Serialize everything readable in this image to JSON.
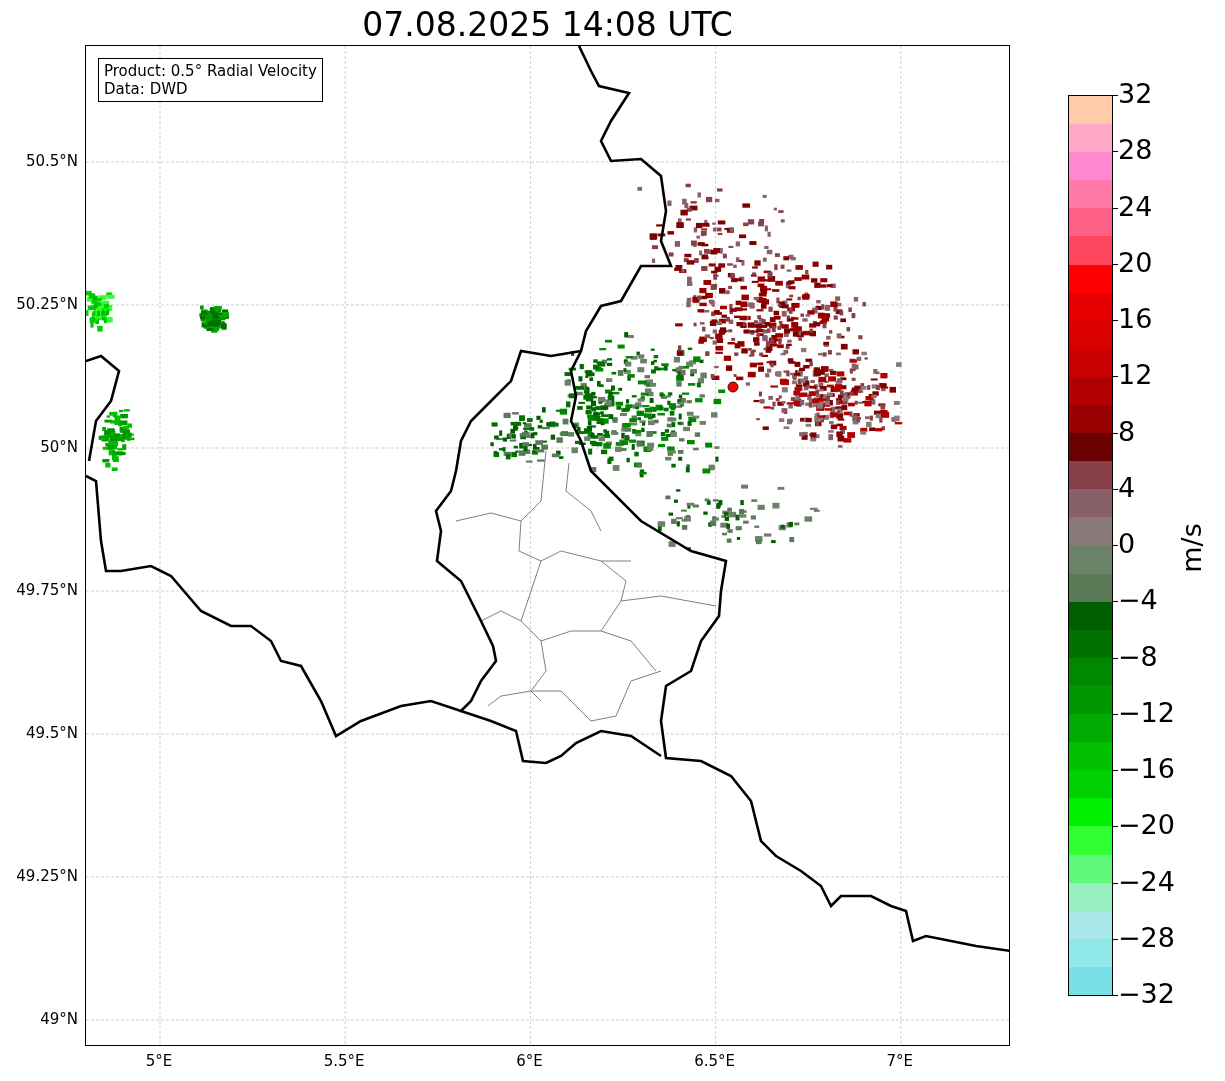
{
  "title": "07.08.2025 14:08 UTC",
  "info_box": {
    "lines": [
      "Product: 0.5° Radial Velocity",
      "Data: DWD"
    ]
  },
  "map": {
    "x_ticks": [
      "5°E",
      "5.5°E",
      "6°E",
      "6.5°E",
      "7°E"
    ],
    "y_ticks": [
      "50.5°N",
      "50.25°N",
      "50°N",
      "49.75°N",
      "49.5°N",
      "49.25°N",
      "49°N"
    ]
  },
  "colorbar": {
    "label": "m/s",
    "ticks": [
      "32",
      "28",
      "24",
      "20",
      "16",
      "12",
      "8",
      "4",
      "0",
      "−4",
      "−8",
      "−12",
      "−16",
      "−20",
      "−24",
      "−28",
      "−32"
    ],
    "segments": [
      {
        "color": "#ffcba8"
      },
      {
        "color": "#ffa8c8"
      },
      {
        "color": "#ff88d0"
      },
      {
        "color": "#ff78a8"
      },
      {
        "color": "#ff6088"
      },
      {
        "color": "#ff4860"
      },
      {
        "color": "#ff0000"
      },
      {
        "color": "#e80000"
      },
      {
        "color": "#d80000"
      },
      {
        "color": "#c80000"
      },
      {
        "color": "#b00000"
      },
      {
        "color": "#980000"
      },
      {
        "color": "#6a0000"
      },
      {
        "color": "#884048"
      },
      {
        "color": "#886068"
      },
      {
        "color": "#887878"
      },
      {
        "color": "#6a8268"
      },
      {
        "color": "#5a7a58"
      },
      {
        "color": "#006000"
      },
      {
        "color": "#007000"
      },
      {
        "color": "#008800"
      },
      {
        "color": "#009800"
      },
      {
        "color": "#00aa00"
      },
      {
        "color": "#00c000"
      },
      {
        "color": "#00d000"
      },
      {
        "color": "#00f000"
      },
      {
        "color": "#30ff30"
      },
      {
        "color": "#60f878"
      },
      {
        "color": "#98f0c0"
      },
      {
        "color": "#a8e8e8"
      },
      {
        "color": "#90e8e8"
      },
      {
        "color": "#78e0e8"
      }
    ]
  }
}
